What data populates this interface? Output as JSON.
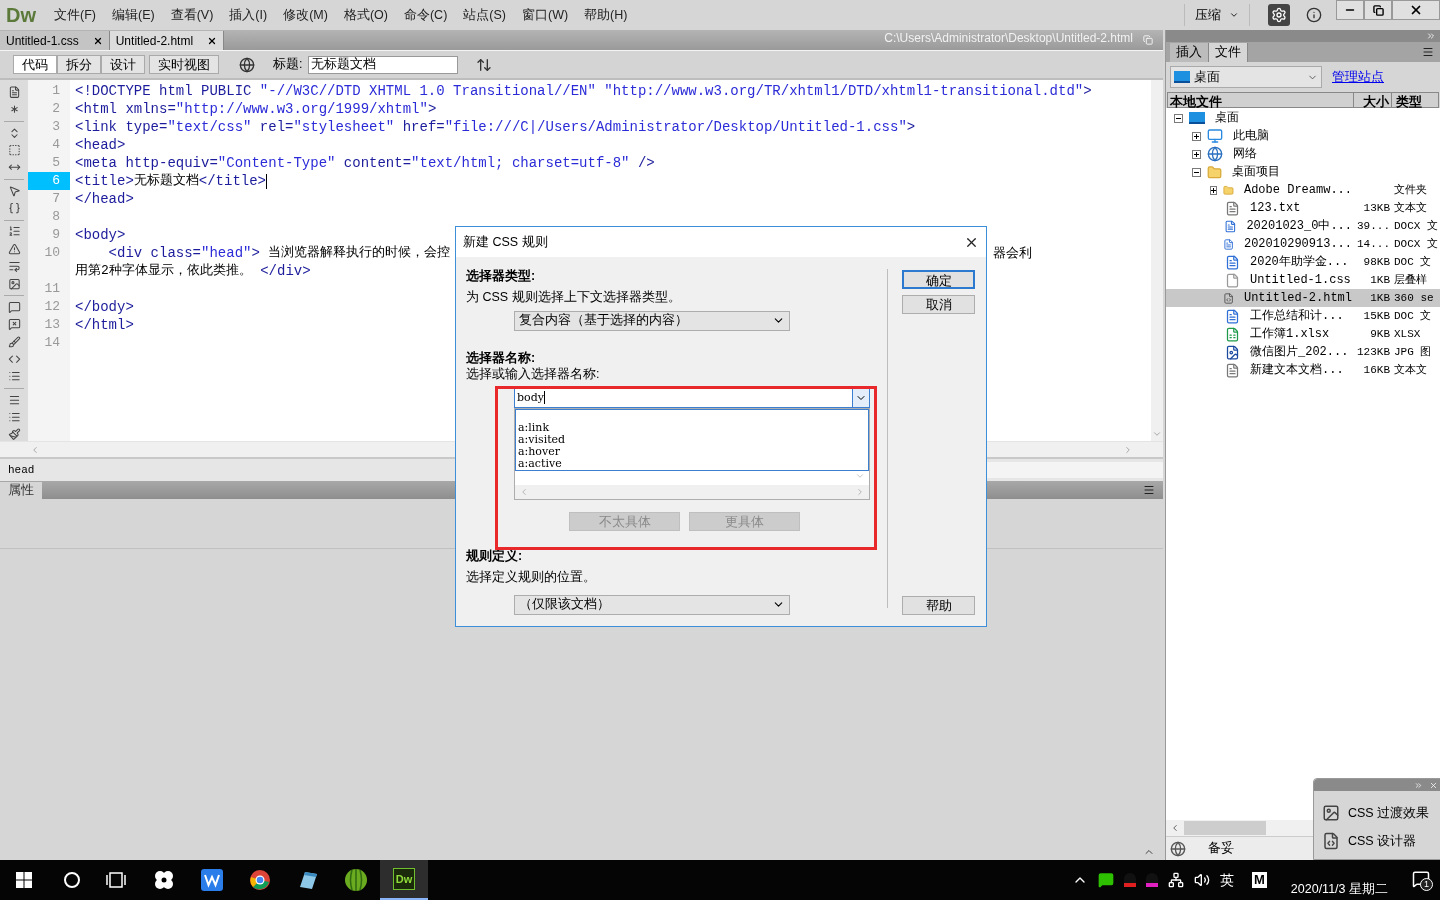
{
  "app": {
    "logo": "Dw"
  },
  "menu": [
    "文件(F)",
    "编辑(E)",
    "查看(V)",
    "插入(I)",
    "修改(M)",
    "格式(O)",
    "命令(C)",
    "站点(S)",
    "窗口(W)",
    "帮助(H)"
  ],
  "workspace": {
    "label": "压缩"
  },
  "doc_tabs": [
    {
      "label": "Untitled-1.css",
      "selected": false
    },
    {
      "label": "Untitled-2.html",
      "selected": true
    }
  ],
  "doc_path": "C:\\Users\\Administrator\\Desktop\\Untitled-2.html",
  "views": [
    {
      "label": "代码",
      "selected": true
    },
    {
      "label": "拆分",
      "selected": false
    },
    {
      "label": "设计",
      "selected": false
    },
    {
      "label": "实时视图",
      "selected": false
    }
  ],
  "title_field": {
    "label": "标题:",
    "value": "无标题文档"
  },
  "code_lines": [
    {
      "number": "1",
      "current": false,
      "segments": [
        {
          "kind": "tag",
          "text": "<!DOCTYPE html PUBLIC "
        },
        {
          "kind": "value",
          "text": "\"-//W3C//DTD XHTML 1.0 Transitional//EN\" \"http://www.w3.org/TR/xhtml1/DTD/xhtml1-transitional.dtd\""
        },
        {
          "kind": "tag",
          "text": ">"
        }
      ]
    },
    {
      "number": "2",
      "current": false,
      "segments": [
        {
          "kind": "tag",
          "text": "<html xmlns="
        },
        {
          "kind": "value",
          "text": "\"http://www.w3.org/1999/xhtml\""
        },
        {
          "kind": "tag",
          "text": ">"
        }
      ]
    },
    {
      "number": "3",
      "current": false,
      "segments": [
        {
          "kind": "tag",
          "text": "<link type="
        },
        {
          "kind": "value",
          "text": "\"text/css\""
        },
        {
          "kind": "tag",
          "text": " rel="
        },
        {
          "kind": "value",
          "text": "\"stylesheet\""
        },
        {
          "kind": "tag",
          "text": " href="
        },
        {
          "kind": "value",
          "text": "\"file:///C|/Users/Administrator/Desktop/Untitled-1.css\""
        },
        {
          "kind": "tag",
          "text": ">"
        }
      ]
    },
    {
      "number": "4",
      "current": false,
      "segments": [
        {
          "kind": "tag",
          "text": "<head>"
        }
      ]
    },
    {
      "number": "5",
      "current": false,
      "segments": [
        {
          "kind": "tag",
          "text": "<meta http-equiv="
        },
        {
          "kind": "value",
          "text": "\"Content-Type\""
        },
        {
          "kind": "tag",
          "text": " content="
        },
        {
          "kind": "value",
          "text": "\"text/html; charset=utf-8\""
        },
        {
          "kind": "tag",
          "text": " />"
        }
      ]
    },
    {
      "number": "6",
      "current": true,
      "segments": [
        {
          "kind": "tag",
          "text": "<title>"
        },
        {
          "kind": "text",
          "text": "无标题文档"
        },
        {
          "kind": "tag",
          "text": "</title>"
        }
      ]
    },
    {
      "number": "7",
      "current": false,
      "segments": [
        {
          "kind": "tag",
          "text": "</head>"
        }
      ]
    },
    {
      "number": "8",
      "current": false
    },
    {
      "number": "9",
      "current": false,
      "segments": [
        {
          "kind": "tag",
          "text": "<body>"
        }
      ]
    },
    {
      "number": "10",
      "current": false,
      "segments": [
        {
          "kind": "tag",
          "text": "    <div class="
        },
        {
          "kind": "value",
          "text": "\"head\""
        },
        {
          "kind": "tag",
          "text": ">"
        },
        {
          "kind": "text",
          "text": " 当浏览器解释执行的时候，会控"
        }
      ],
      "tail": [
        {
          "kind": "text",
          "text": "器会利"
        }
      ],
      "wrap": [
        {
          "kind": "text",
          "text": "用第2种字体显示，依此类推。"
        },
        {
          "kind": "tag",
          "text": " </div>"
        }
      ]
    },
    {
      "number": "11",
      "current": false
    },
    {
      "number": "12",
      "current": false,
      "segments": [
        {
          "kind": "tag",
          "text": "</body>"
        }
      ]
    },
    {
      "number": "13",
      "current": false,
      "segments": [
        {
          "kind": "tag",
          "text": "</html>"
        }
      ]
    },
    {
      "number": "14",
      "current": false
    }
  ],
  "tag_selector": "head",
  "properties": {
    "label": "属性"
  },
  "dialog": {
    "title": "新建 CSS 规则",
    "type_heading": "选择器类型:",
    "type_hint": "为 CSS 规则选择上下文选择器类型。",
    "type_value": "复合内容（基于选择的内容）",
    "name_heading": "选择器名称:",
    "name_hint": "选择或输入选择器名称:",
    "name_value": "body",
    "name_options": [
      "a:link",
      "a:visited",
      "a:hover",
      "a:active"
    ],
    "specific_buttons": [
      {
        "label": "不太具体",
        "disabled": true
      },
      {
        "label": "更具体",
        "disabled": true
      }
    ],
    "rule_heading": "规则定义:",
    "rule_hint": "选择定义规则的位置。",
    "rule_value": "（仅限该文档）",
    "buttons": [
      {
        "label": "确定",
        "default": true
      },
      {
        "label": "取消",
        "default": false
      },
      {
        "label": "帮助",
        "default": false
      }
    ]
  },
  "files_panel": {
    "tabs": [
      {
        "label": "插入",
        "selected": false
      },
      {
        "label": "文件",
        "selected": true
      }
    ],
    "site": "桌面",
    "manage_link": "管理站点",
    "columns": [
      "本地文件",
      "大小",
      "类型"
    ],
    "tree": [
      {
        "label": "桌面",
        "kind": "monitor",
        "expanded": true,
        "selected": false,
        "children": [
          {
            "label": "此电脑",
            "kind": "pc",
            "expanded": false,
            "selected": false
          },
          {
            "label": "网络",
            "kind": "network",
            "expanded": false,
            "selected": false
          },
          {
            "label": "桌面项目",
            "kind": "folder",
            "expanded": true,
            "selected": false,
            "children": [
              {
                "label": "Adobe Dreamw...",
                "kind": "folder",
                "expanded": false,
                "selected": false,
                "type": "文件夹"
              },
              {
                "label": "123.txt",
                "kind": "text",
                "selected": false,
                "size": "13KB",
                "type": "文本文"
              },
              {
                "label": "20201023_0中...",
                "kind": "word",
                "selected": false,
                "size": "39...",
                "type": "DOCX 文"
              },
              {
                "label": "202010290913...",
                "kind": "word",
                "selected": false,
                "size": "14...",
                "type": "DOCX 文"
              },
              {
                "label": "2020年助学金...",
                "kind": "word",
                "selected": false,
                "size": "98KB",
                "type": "DOC 文"
              },
              {
                "label": "Untitled-1.css",
                "kind": "css",
                "selected": false,
                "size": "1KB",
                "type": "层叠样"
              },
              {
                "label": "Untitled-2.html",
                "kind": "html",
                "selected": true,
                "size": "1KB",
                "type": "360 se"
              },
              {
                "label": "工作总结和计...",
                "kind": "word",
                "selected": false,
                "size": "15KB",
                "type": "DOC 文"
              },
              {
                "label": "工作簿1.xlsx",
                "kind": "excel",
                "selected": false,
                "size": "9KB",
                "type": "XLSX"
              },
              {
                "label": "微信图片_202...",
                "kind": "image",
                "selected": false,
                "size": "123KB",
                "type": "JPG 图"
              },
              {
                "label": "新建文本文档...",
                "kind": "text",
                "selected": false,
                "size": "16KB",
                "type": "文本文"
              }
            ]
          }
        ]
      }
    ],
    "status": "备妥"
  },
  "float_panel": {
    "items": [
      {
        "label": "CSS 过渡效果",
        "kind": "transition"
      },
      {
        "label": "CSS 设计器",
        "kind": "css"
      }
    ]
  },
  "taskbar": {
    "apps": [
      {
        "kind": "fan",
        "selected": false
      },
      {
        "kind": "writer",
        "selected": false
      },
      {
        "kind": "chrome",
        "selected": false
      },
      {
        "kind": "notes",
        "selected": false
      },
      {
        "kind": "melon",
        "selected": false
      },
      {
        "kind": "dw",
        "label": "Dw",
        "selected": true
      }
    ],
    "ime": "英",
    "m_badge": "M",
    "date": "2020/11/3 星期二",
    "notifications": "1"
  }
}
